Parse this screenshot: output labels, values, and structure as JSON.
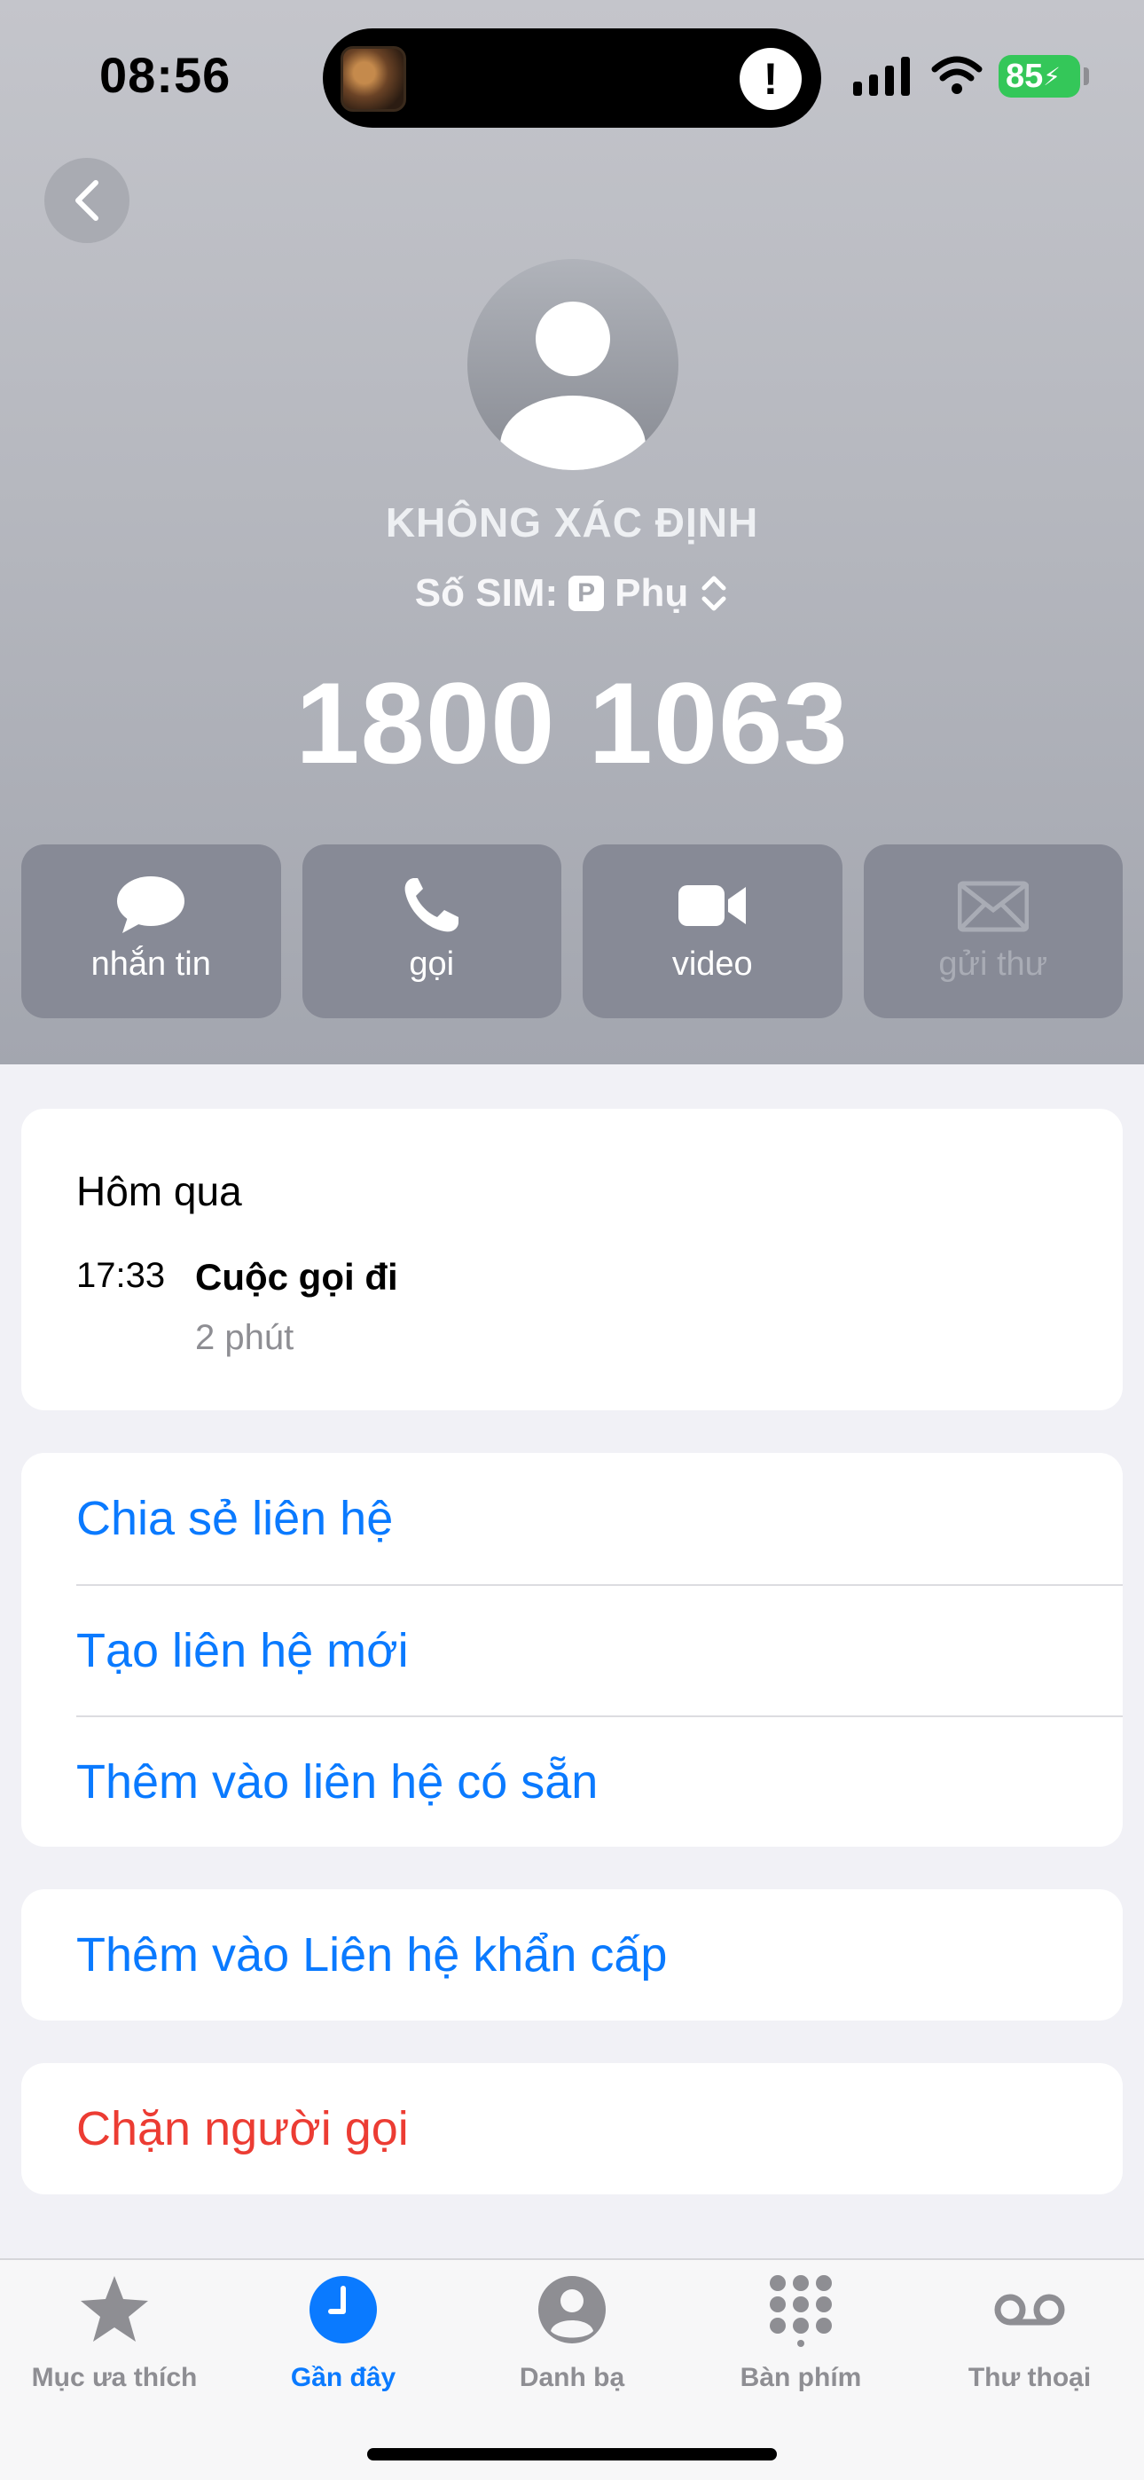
{
  "status_bar": {
    "time": "08:56",
    "battery": "85"
  },
  "contact": {
    "name": "KHÔNG XÁC ĐỊNH",
    "sim_label": "Số SIM:",
    "sim_badge": "P",
    "sim_value": "Phụ",
    "number": "1800 1063"
  },
  "actions": [
    {
      "label": "nhắn tin",
      "icon": "message-icon",
      "enabled": true
    },
    {
      "label": "gọi",
      "icon": "phone-icon",
      "enabled": true
    },
    {
      "label": "video",
      "icon": "video-icon",
      "enabled": true
    },
    {
      "label": "gửi thư",
      "icon": "mail-icon",
      "enabled": false
    }
  ],
  "history": {
    "day": "Hôm qua",
    "time": "17:33",
    "type": "Cuộc gọi đi",
    "duration": "2 phút"
  },
  "contact_options": [
    "Chia sẻ liên hệ",
    "Tạo liên hệ mới",
    "Thêm vào liên hệ có sẵn"
  ],
  "emergency": "Thêm vào Liên hệ khẩn cấp",
  "block": "Chặn người gọi",
  "tabs": [
    {
      "label": "Mục ưa thích",
      "icon": "star-icon",
      "active": false
    },
    {
      "label": "Gần đây",
      "icon": "clock-icon",
      "active": true
    },
    {
      "label": "Danh bạ",
      "icon": "person-icon",
      "active": false
    },
    {
      "label": "Bàn phím",
      "icon": "keypad-icon",
      "active": false
    },
    {
      "label": "Thư thoại",
      "icon": "voicemail-icon",
      "active": false
    }
  ],
  "colors": {
    "accent": "#0a7aff",
    "destructive": "#ec3c33",
    "battery": "#34c759"
  }
}
